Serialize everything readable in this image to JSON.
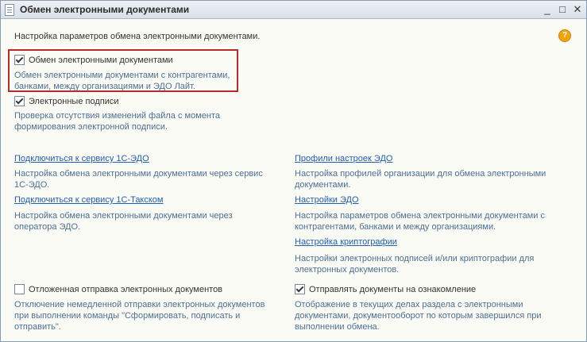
{
  "window": {
    "title": "Обмен электронными документами",
    "minimize_glyph": "_",
    "maximize_glyph": "□",
    "close_glyph": "✕"
  },
  "intro": "Настройка параметров обмена электронными документами.",
  "help_glyph": "?",
  "checkboxes": {
    "edo": {
      "label": "Обмен электронными документами",
      "checked": true,
      "desc_line1": "Обмен электронными документами с контрагентами,",
      "desc_line2": "банками, между организациями и ЭДО Лайт."
    },
    "signatures": {
      "label": "Электронные подписи",
      "checked": true,
      "desc_line1": "Проверка отсутствия изменений файла с момента",
      "desc_line2": "формирования электронной подписи."
    },
    "deferred": {
      "label": "Отложенная отправка электронных документов",
      "checked": false,
      "desc_line1": "Отключение немедленной отправки электронных документов",
      "desc_line2": "при выполнении команды \"Сформировать, подписать и",
      "desc_line3": "отправить\"."
    },
    "review": {
      "label": "Отправлять документы на ознакомление",
      "checked": true,
      "desc_line1": "Отображение в текущих делах  раздела с электронными",
      "desc_line2": "документами, документооборот по которым завершился при",
      "desc_line3": "выполнении обмена."
    }
  },
  "links": {
    "connect_1c_edo": {
      "label": "Подключиться к сервису 1С-ЭДО",
      "desc_line1": "Настройка обмена электронными документами через сервис",
      "desc_line2": "1С-ЭДО."
    },
    "connect_taxcom": {
      "label": "Подключиться к сервису 1С-Такском",
      "desc_line1": "Настройка обмена электронными документами через",
      "desc_line2": "оператора ЭДО."
    },
    "profiles": {
      "label": "Профили настроек ЭДО",
      "desc_line1": "Настройка профилей организации для обмена электронными",
      "desc_line2": "документами."
    },
    "settings": {
      "label": "Настройки ЭДО",
      "desc_line1": "Настройка параметров обмена электронными документами с",
      "desc_line2": "контрагентами, банками и между организациями."
    },
    "crypto": {
      "label": "Настройка криптографии",
      "desc_line1": "Настройки электронных подписей и/или криптографии для",
      "desc_line2": "электронных документов."
    }
  },
  "colors": {
    "link": "#1f5fb4",
    "description": "#4d6f92",
    "highlight_border": "#b72b2b",
    "help_icon": "#f0a30a"
  },
  "icons": {
    "app": "document-icon",
    "help": "help-icon"
  }
}
